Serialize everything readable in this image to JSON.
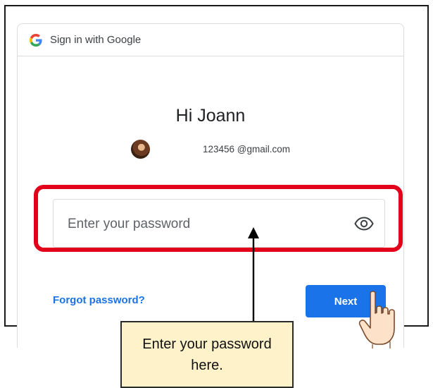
{
  "header": {
    "title": "Sign in with Google",
    "logo_icon": "google-g-icon"
  },
  "greeting": "Hi Joann",
  "account": {
    "email": "123456 @gmail.com",
    "avatar_icon": "avatar"
  },
  "password": {
    "placeholder": "Enter your password",
    "value": "",
    "toggle_icon": "eye-icon"
  },
  "actions": {
    "forgot_label": "Forgot password?",
    "next_label": "Next"
  },
  "annotation": {
    "callout_text": "Enter your password here.",
    "highlight_color": "#e2001a",
    "callout_bg": "#fef2cb"
  },
  "colors": {
    "primary": "#1a73e8",
    "border": "#dadce0"
  }
}
